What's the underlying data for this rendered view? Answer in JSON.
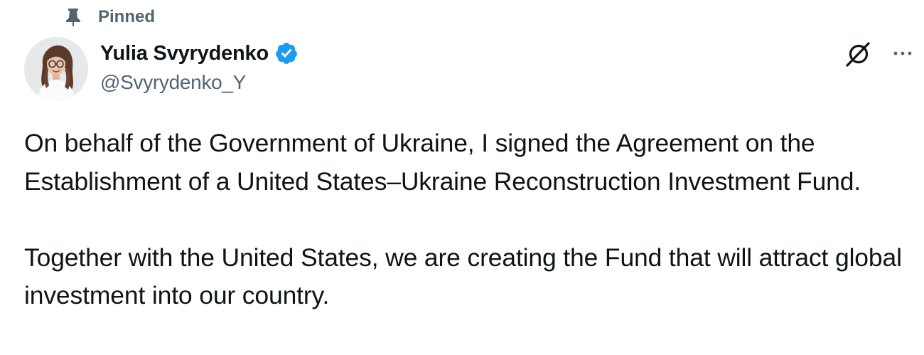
{
  "pinned": {
    "label": "Pinned",
    "icon": "pin-icon"
  },
  "author": {
    "display_name": "Yulia Svyrydenko",
    "handle": "@Svyrydenko_Y",
    "verified": true,
    "verified_color": "#1d9bf0",
    "avatar_icon": "avatar"
  },
  "actions": {
    "grok_icon": "grok-icon",
    "more_icon": "more-icon"
  },
  "tweet": {
    "paragraphs": [
      "On behalf of the Government of Ukraine, I signed the Agreement on the Establishment of a United States–Ukraine Reconstruction Investment Fund.",
      "Together with the United States, we are creating the Fund that will attract global investment into our country."
    ]
  },
  "colors": {
    "text_primary": "#0f1419",
    "text_secondary": "#536471",
    "accent": "#1d9bf0"
  }
}
